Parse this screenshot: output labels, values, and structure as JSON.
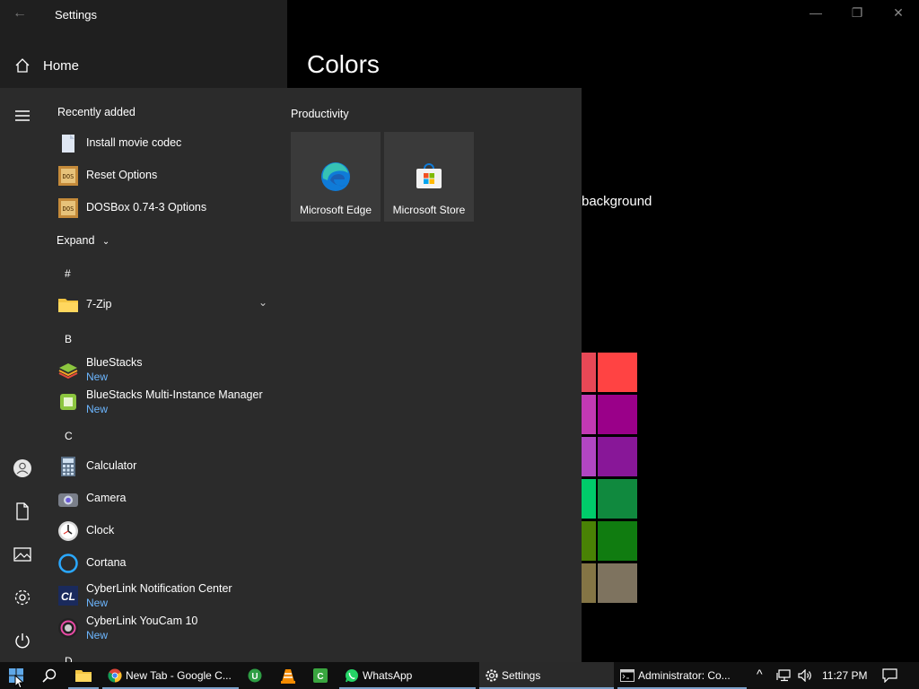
{
  "settings": {
    "title": "Settings",
    "home_label": "Home",
    "page_title": "Colors",
    "background_fragment": "background",
    "controls": {
      "minimize": "—",
      "restore": "❐",
      "close": "✕"
    }
  },
  "start_menu": {
    "recently_added_label": "Recently added",
    "expand_label": "Expand",
    "recent": [
      {
        "name": "Install movie codec"
      },
      {
        "name": "Reset Options"
      },
      {
        "name": "DOSBox 0.74-3 Options"
      }
    ],
    "letters": {
      "hash": "#",
      "b": "B",
      "c": "C",
      "d": "D"
    },
    "apps": [
      {
        "name": "7-Zip",
        "sub": ""
      },
      {
        "name": "BlueStacks",
        "sub": "New"
      },
      {
        "name": "BlueStacks Multi-Instance Manager",
        "sub": "New"
      },
      {
        "name": "Calculator",
        "sub": ""
      },
      {
        "name": "Camera",
        "sub": ""
      },
      {
        "name": "Clock",
        "sub": ""
      },
      {
        "name": "Cortana",
        "sub": ""
      },
      {
        "name": "CyberLink Notification Center",
        "sub": "New"
      },
      {
        "name": "CyberLink YouCam 10",
        "sub": "New"
      }
    ],
    "group_label": "Productivity",
    "tiles": [
      {
        "label": "Microsoft Edge"
      },
      {
        "label": "Microsoft Store"
      }
    ]
  },
  "taskbar": {
    "items": [
      {
        "label": "New Tab - Google C..."
      },
      {
        "label": "WhatsApp"
      },
      {
        "label": "Settings"
      },
      {
        "label": "Administrator: Co..."
      }
    ],
    "clock": "11:27 PM"
  },
  "colors": {
    "accent": "#7aa0c8",
    "new_badge": "#6cb6ff",
    "swatches": [
      "#e74856",
      "#ff4343",
      "#c239b3",
      "#9a0089",
      "#b146c2",
      "#881798",
      "#00cc6a",
      "#10893e",
      "#498205",
      "#107c10",
      "#847545",
      "#7e735f"
    ]
  }
}
